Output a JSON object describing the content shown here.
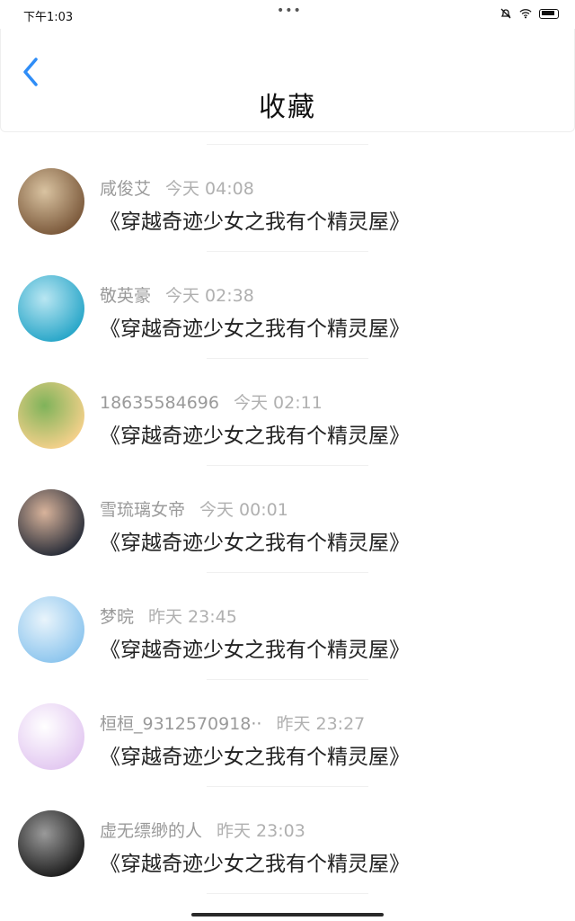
{
  "status": {
    "time": "下午1:03",
    "dots": "•••"
  },
  "header": {
    "title": "收藏"
  },
  "colors": {
    "accent": "#2f8df7"
  },
  "favorites": [
    {
      "name": "咸俊艾",
      "time": "今天 04:08",
      "content": "《穿越奇迹少女之我有个精灵屋》",
      "avatar_colors": [
        "#7c5a3c",
        "#d9c3a1"
      ]
    },
    {
      "name": "敬英豪",
      "time": "今天 02:38",
      "content": "《穿越奇迹少女之我有个精灵屋》",
      "avatar_colors": [
        "#2aa7c9",
        "#b9e6f2"
      ]
    },
    {
      "name": "18635584696",
      "time": "今天 02:11",
      "content": "《穿越奇迹少女之我有个精灵屋》",
      "avatar_colors": [
        "#f3d08a",
        "#7fb35a"
      ]
    },
    {
      "name": "雪琉璃女帝",
      "time": "今天 00:01",
      "content": "《穿越奇迹少女之我有个精灵屋》",
      "avatar_colors": [
        "#2b2f3a",
        "#d8b39b"
      ]
    },
    {
      "name": "梦晥",
      "time": "昨天 23:45",
      "content": "《穿越奇迹少女之我有个精灵屋》",
      "avatar_colors": [
        "#8ec6ee",
        "#e9f4fb"
      ]
    },
    {
      "name": "桓桓_9312570918··",
      "time": "昨天 23:27",
      "content": "《穿越奇迹少女之我有个精灵屋》",
      "avatar_colors": [
        "#e3c9f1",
        "#ffffff"
      ]
    },
    {
      "name": "虚无缥缈的人",
      "time": "昨天 23:03",
      "content": "《穿越奇迹少女之我有个精灵屋》",
      "avatar_colors": [
        "#1f1f1f",
        "#9a9a9a"
      ]
    }
  ]
}
